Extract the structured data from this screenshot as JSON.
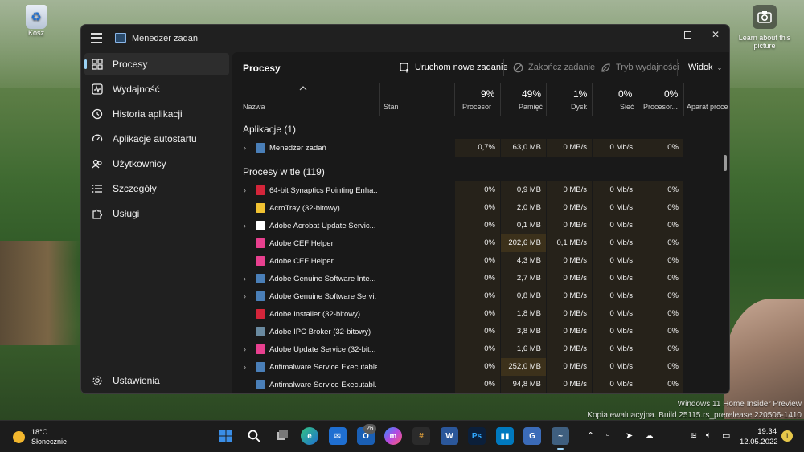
{
  "desktop": {
    "recycle_bin_label": "Kosz",
    "learn_label": "Learn about this picture",
    "watermark_line1": "Windows 11 Home Insider Preview",
    "watermark_line2": "Kopia ewaluacyjna. Build 25115.rs_prerelease.220506-1410"
  },
  "window": {
    "title": "Menedżer zadań",
    "controls": {
      "minimize": "minimize",
      "maximize": "maximize",
      "close": "✕"
    }
  },
  "sidebar": {
    "items": [
      {
        "label": "Procesy",
        "icon": "grid-icon",
        "active": true
      },
      {
        "label": "Wydajność",
        "icon": "pulse-icon"
      },
      {
        "label": "Historia aplikacji",
        "icon": "history-icon"
      },
      {
        "label": "Aplikacje autostartu",
        "icon": "speedometer-icon"
      },
      {
        "label": "Użytkownicy",
        "icon": "users-icon"
      },
      {
        "label": "Szczegóły",
        "icon": "list-icon"
      },
      {
        "label": "Usługi",
        "icon": "puzzle-icon"
      }
    ],
    "settings_label": "Ustawienia"
  },
  "toolbar": {
    "title": "Procesy",
    "new_task": "Uruchom nowe zadanie",
    "end_task": "Zakończ zadanie",
    "efficiency": "Tryb wydajności",
    "view": "Widok"
  },
  "table": {
    "columns": {
      "name": "Nazwa",
      "status": "Stan",
      "cpu": {
        "pct": "9%",
        "label": "Procesor"
      },
      "mem": {
        "pct": "49%",
        "label": "Pamięć"
      },
      "disk": {
        "pct": "1%",
        "label": "Dysk"
      },
      "net": {
        "pct": "0%",
        "label": "Sieć"
      },
      "gpu": {
        "pct": "0%",
        "label": "Procesor..."
      },
      "gpu_engine": "Aparat proce"
    },
    "group_apps": "Aplikacje (1)",
    "group_bg": "Procesy w tle (119)",
    "apps": [
      {
        "name": "Menedżer zadań",
        "cpu": "0,7%",
        "mem": "63,0 MB",
        "disk": "0 MB/s",
        "net": "0 Mb/s",
        "gpu": "0%",
        "expand": true,
        "icon_color": "#4a7fb8"
      }
    ],
    "background": [
      {
        "name": "64-bit Synaptics Pointing Enha...",
        "cpu": "0%",
        "mem": "0,9 MB",
        "disk": "0 MB/s",
        "net": "0 Mb/s",
        "gpu": "0%",
        "expand": true,
        "icon_color": "#d4253a"
      },
      {
        "name": "AcroTray (32-bitowy)",
        "cpu": "0%",
        "mem": "2,0 MB",
        "disk": "0 MB/s",
        "net": "0 Mb/s",
        "gpu": "0%",
        "expand": false,
        "icon_color": "#f1c232"
      },
      {
        "name": "Adobe Acrobat Update Servic...",
        "cpu": "0%",
        "mem": "0,1 MB",
        "disk": "0 MB/s",
        "net": "0 Mb/s",
        "gpu": "0%",
        "expand": true,
        "icon_color": "#ffffff"
      },
      {
        "name": "Adobe CEF Helper",
        "cpu": "0%",
        "mem": "202,6 MB",
        "disk": "0,1 MB/s",
        "net": "0 Mb/s",
        "gpu": "0%",
        "expand": false,
        "icon_color": "#e8408f",
        "mem_hot": true
      },
      {
        "name": "Adobe CEF Helper",
        "cpu": "0%",
        "mem": "4,3 MB",
        "disk": "0 MB/s",
        "net": "0 Mb/s",
        "gpu": "0%",
        "expand": false,
        "icon_color": "#e8408f"
      },
      {
        "name": "Adobe Genuine Software Inte...",
        "cpu": "0%",
        "mem": "2,7 MB",
        "disk": "0 MB/s",
        "net": "0 Mb/s",
        "gpu": "0%",
        "expand": true,
        "icon_color": "#4a7fb8"
      },
      {
        "name": "Adobe Genuine Software Servi...",
        "cpu": "0%",
        "mem": "0,8 MB",
        "disk": "0 MB/s",
        "net": "0 Mb/s",
        "gpu": "0%",
        "expand": true,
        "icon_color": "#4a7fb8"
      },
      {
        "name": "Adobe Installer (32-bitowy)",
        "cpu": "0%",
        "mem": "1,8 MB",
        "disk": "0 MB/s",
        "net": "0 Mb/s",
        "gpu": "0%",
        "expand": false,
        "icon_color": "#d4253a"
      },
      {
        "name": "Adobe IPC Broker (32-bitowy)",
        "cpu": "0%",
        "mem": "3,8 MB",
        "disk": "0 MB/s",
        "net": "0 Mb/s",
        "gpu": "0%",
        "expand": false,
        "icon_color": "#6a8aa0"
      },
      {
        "name": "Adobe Update Service (32-bit...",
        "cpu": "0%",
        "mem": "1,6 MB",
        "disk": "0 MB/s",
        "net": "0 Mb/s",
        "gpu": "0%",
        "expand": true,
        "icon_color": "#e8408f"
      },
      {
        "name": "Antimalware Service Executable",
        "cpu": "0%",
        "mem": "252,0 MB",
        "disk": "0 MB/s",
        "net": "0 Mb/s",
        "gpu": "0%",
        "expand": true,
        "icon_color": "#4a7fb8",
        "mem_hot": true
      },
      {
        "name": "Antimalware Service Executabl...",
        "cpu": "0%",
        "mem": "94,8 MB",
        "disk": "0 MB/s",
        "net": "0 Mb/s",
        "gpu": "0%",
        "expand": false,
        "icon_color": "#4a7fb8"
      }
    ]
  },
  "taskbar": {
    "temperature": "18°C",
    "condition": "Słonecznie",
    "mail_badge": "26",
    "time": "19:34",
    "date": "12.05.2022",
    "notif_count": "1",
    "apps": [
      {
        "id": "start-icon",
        "color": "#3a8ee6"
      },
      {
        "id": "search-icon",
        "color": "transparent"
      },
      {
        "id": "task-view-icon",
        "color": "transparent"
      },
      {
        "id": "edge-icon",
        "color": "#1ea05f"
      },
      {
        "id": "mail-icon",
        "color": "#1f6fd1"
      },
      {
        "id": "outlook-icon",
        "color": "#1a5fb4"
      },
      {
        "id": "messenger-icon",
        "color": "#9b4de0"
      },
      {
        "id": "slack-icon",
        "color": "#e5a33a"
      },
      {
        "id": "word-icon",
        "color": "#2b579a"
      },
      {
        "id": "photoshop-icon",
        "color": "#0b1f3a"
      },
      {
        "id": "trello-icon",
        "color": "#0079bf"
      },
      {
        "id": "translator-icon",
        "color": "#3b6bb8"
      },
      {
        "id": "task-manager-icon",
        "color": "#3f5f7f"
      }
    ]
  }
}
